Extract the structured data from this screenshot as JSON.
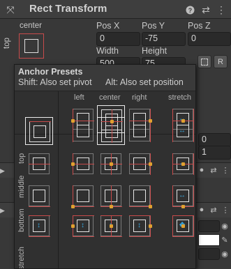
{
  "header": {
    "title": "Rect Transform",
    "icons": [
      "expand-icon",
      "help-icon",
      "settings-icon",
      "more-icon"
    ]
  },
  "anchor_widget": {
    "top_label": "center",
    "side_label": "top"
  },
  "position": {
    "pos_x_label": "Pos X",
    "pos_x_value": "0",
    "pos_y_label": "Pos Y",
    "pos_y_value": "-75",
    "pos_z_label": "Pos Z",
    "pos_z_value": "0",
    "width_label": "Width",
    "width_value": "500",
    "height_label": "Height",
    "height_value": "75",
    "raw_button": "R"
  },
  "right_values": {
    "value_a": "0",
    "value_b": "1"
  },
  "popup": {
    "title": "Anchor Presets",
    "hint_shift": "Shift: Also set pivot",
    "hint_alt": "Alt: Also set position",
    "columns": [
      "left",
      "center",
      "right",
      "stretch"
    ],
    "rows": [
      "top",
      "middle",
      "bottom",
      "stretch"
    ]
  },
  "colors": {
    "accent_red": "#c84b4b",
    "pivot_orange": "#e0a030",
    "stretch_blue": "#39a9e0"
  }
}
